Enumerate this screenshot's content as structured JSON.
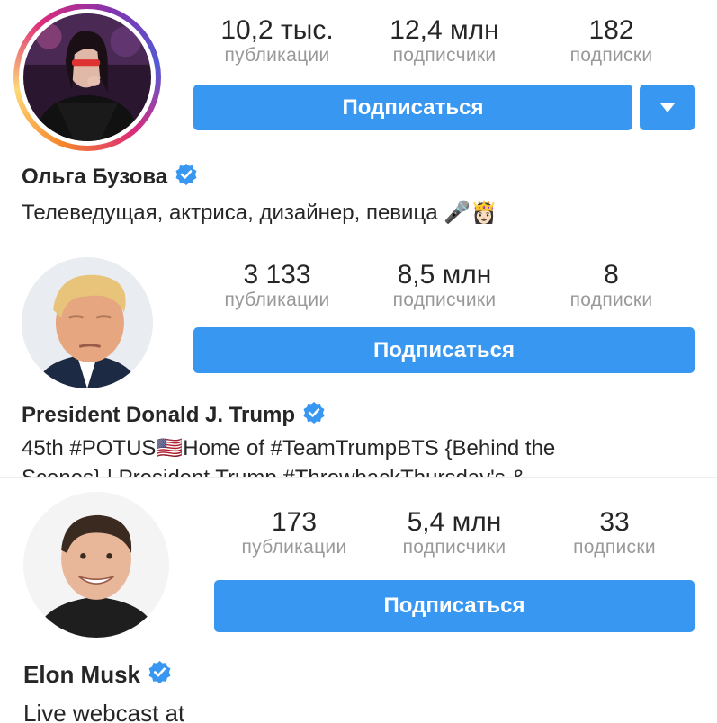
{
  "profiles": [
    {
      "stats": [
        {
          "value": "10,2 тыс.",
          "label": "публикации"
        },
        {
          "value": "12,4 млн",
          "label": "подписчики"
        },
        {
          "value": "182",
          "label": "подписки"
        }
      ],
      "follow_label": "Подписаться",
      "name": "Ольга Бузова",
      "bio": "Телеведущая, актриса, дизайнер, певица 🎤👸🏻",
      "has_story_ring": true
    },
    {
      "stats": [
        {
          "value": "3 133",
          "label": "публикации"
        },
        {
          "value": "8,5 млн",
          "label": "подписчики"
        },
        {
          "value": "8",
          "label": "подписки"
        }
      ],
      "follow_label": "Подписаться",
      "name": "President Donald J. Trump",
      "bio_line1": "45th #POTUS🇺🇸Home of #TeamTrumpBTS {Behind the",
      "bio_line2": "Scenes} | President Trump #ThrowbackThursday's &"
    },
    {
      "stats": [
        {
          "value": "173",
          "label": "публикации"
        },
        {
          "value": "5,4 млн",
          "label": "подписчики"
        },
        {
          "value": "33",
          "label": "подписки"
        }
      ],
      "follow_label": "Подписаться",
      "name": "Elon Musk",
      "bio": "Live webcast at"
    }
  ],
  "colors": {
    "button_blue": "#3897f0",
    "verified_blue": "#3897f0",
    "label_gray": "#999999",
    "text": "#262626"
  }
}
